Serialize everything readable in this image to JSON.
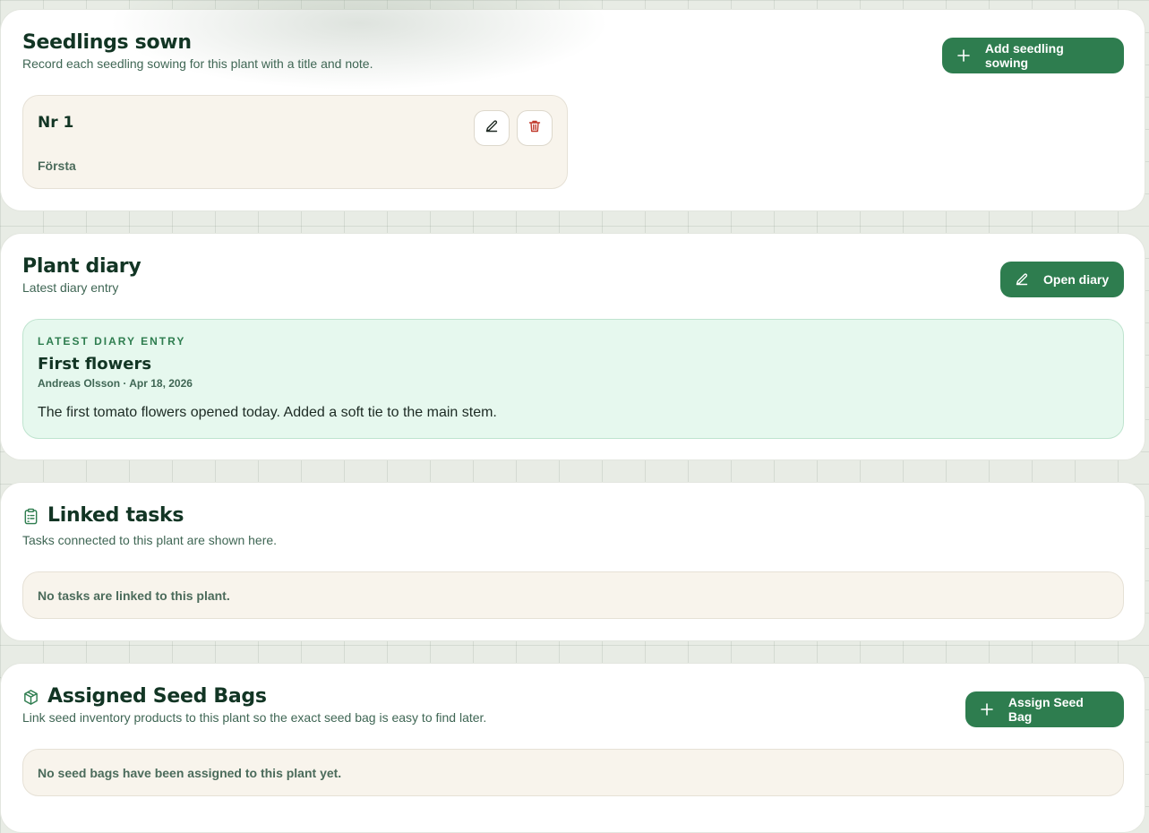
{
  "seedlings": {
    "title": "Seedlings sown",
    "subtitle": "Record each seedling sowing for this plant with a title and note.",
    "add_button": "Add seedling sowing",
    "items": [
      {
        "title": "Nr 1",
        "note": "Första"
      }
    ]
  },
  "diary": {
    "title": "Plant diary",
    "subtitle": "Latest diary entry",
    "open_button": "Open diary",
    "entry_label": "LATEST DIARY ENTRY",
    "entry_title": "First flowers",
    "entry_meta": "Andreas Olsson · Apr 18, 2026",
    "entry_body": "The first tomato flowers opened today. Added a soft tie to the main stem."
  },
  "tasks": {
    "title": "Linked tasks",
    "subtitle": "Tasks connected to this plant are shown here.",
    "empty": "No tasks are linked to this plant."
  },
  "seed_bags": {
    "title": "Assigned Seed Bags",
    "subtitle": "Link seed inventory products to this plant so the exact seed bag is easy to find later.",
    "assign_button": "Assign Seed Bag",
    "empty": "No seed bags have been assigned to this plant yet."
  },
  "colors": {
    "primary": "#2e7d4f",
    "title": "#123524",
    "danger": "#c0392b",
    "mint_bg": "#e6f8ee",
    "beige_bg": "#f8f4ec"
  },
  "icons": {
    "add": "plus-icon",
    "edit": "pencil-icon",
    "delete": "trash-icon",
    "tasks": "clipboard-list-icon",
    "seed_bags": "package-icon"
  }
}
